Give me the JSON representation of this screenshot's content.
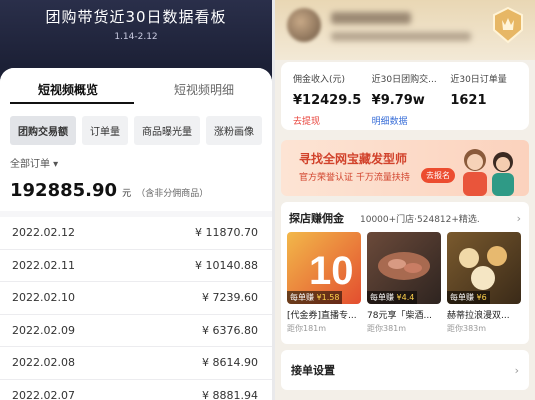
{
  "left": {
    "title": "团购带货近30日数据看板",
    "date_range": "1.14-2.12",
    "tabs": [
      "短视频概览",
      "短视频明细"
    ],
    "chips": [
      "团购交易额",
      "订单量",
      "商品曝光量",
      "涨粉画像"
    ],
    "filter": "全部订单 ▾",
    "total": "192885.90",
    "total_unit": "元",
    "total_note": "（含非分佣商品）",
    "rows": [
      {
        "date": "2022.02.12",
        "amount": "¥ 11870.70"
      },
      {
        "date": "2022.02.11",
        "amount": "¥ 10140.88"
      },
      {
        "date": "2022.02.10",
        "amount": "¥ 7239.60"
      },
      {
        "date": "2022.02.09",
        "amount": "¥ 6376.80"
      },
      {
        "date": "2022.02.08",
        "amount": "¥ 8614.90"
      },
      {
        "date": "2022.02.07",
        "amount": "¥ 8881.94"
      }
    ]
  },
  "right": {
    "stats": [
      {
        "label": "佣金收入(元)",
        "value": "¥12429.5",
        "link": "去提现"
      },
      {
        "label": "近30日团购交...",
        "value": "¥9.79w",
        "link": "明细数据"
      },
      {
        "label": "近30日订单量",
        "value": "1621",
        "link": ""
      }
    ],
    "banner": {
      "title": "寻找全网宝藏发型师",
      "subtitle": "官方荣誉认证 千万流量扶持",
      "button": "去报名"
    },
    "shop": {
      "title": "探店赚佣金",
      "meta": "10000+门店·524812+精选...",
      "cards": [
        {
          "name": "[代金券]直播专...",
          "earn_prefix": "每单赚",
          "earn": "¥1.58",
          "dist": "距你181m"
        },
        {
          "name": "78元享「柴酒...",
          "earn_prefix": "每单赚",
          "earn": "¥4.4",
          "dist": "距你381m"
        },
        {
          "name": "赫蒂拉浪漫双...",
          "earn_prefix": "每单赚",
          "earn": "¥6",
          "dist": "距你383m"
        }
      ]
    },
    "order_settings": "接单设置"
  },
  "colors": {
    "accent_red": "#e84a32",
    "link_red": "#e8423a",
    "link_blue": "#3a6fd8"
  }
}
